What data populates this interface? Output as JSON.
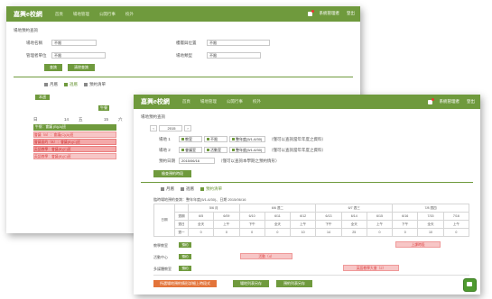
{
  "back_window": {
    "logo": "嘉興e校網",
    "nav": [
      "首頁",
      "場地管理",
      "公開行事",
      "校外"
    ],
    "topright": [
      "系統管理者",
      "登出"
    ],
    "section": "場地預約查詢",
    "fields": {
      "site": "場地名稱",
      "site_val": "不限",
      "bldg": "樓層與位置",
      "bldg_val": "不限",
      "manager": "管理者單位",
      "manager_val": "不限",
      "kind": "場地類型",
      "kind_val": "不限"
    },
    "buttons": {
      "query": "查詢",
      "reset": "清除查詢"
    },
    "tabs": [
      "月曆",
      "週曆",
      "預約清單"
    ],
    "week_btn": "本週",
    "col_labels": [
      "日",
      "14",
      "五",
      "15",
      "六"
    ],
    "green_tag": "午餐",
    "events": [
      "午餐：會議 (B)(A)班",
      "會議（B）：會議(C)(A)班",
      "會議區的（B）：會議(B)(C)班",
      "英語教學：會議(B)(C)班",
      "英語教學：會議(B)(C)班"
    ]
  },
  "front_window": {
    "logo": "嘉興e校網",
    "nav": [
      "首頁",
      "場地管理",
      "公開行事",
      "校外"
    ],
    "topright": [
      "系統管理者",
      "登出"
    ],
    "section": "場地預約查詢",
    "year": "2015",
    "rows": [
      {
        "label": "場地 1",
        "opts": [
          "教室",
          "不限",
          "整年度(5/1-6/30)"
        ],
        "note": "（僅可以查詢當年年度之資料）"
      },
      {
        "label": "場地 2",
        "opts": [
          "會議室",
          "活動室",
          "整年度(5/1-6/30)"
        ],
        "note": "（僅可以查詢當年年度之資料）"
      },
      {
        "label": "預約日期",
        "opts": [
          "2015/06/16"
        ],
        "note": "（僅可以查詢本學期之預約情形）"
      }
    ],
    "query_btn": "檢查預約時段",
    "tabs": [
      "月曆",
      "週曆",
      "預約清單"
    ],
    "sched_title": "臨時場地預約查詢：整年年度(5/1-6/30)、日期 2015/06/16",
    "headers": [
      "日期",
      "5/6 月",
      "6/6 週二",
      "6/7 週三",
      "7/8 週四"
    ],
    "subheaders": [
      "週期",
      "週日",
      "週一",
      "週二",
      "週三",
      "週四",
      "週五",
      "週六",
      "週日",
      "週一",
      "週二"
    ],
    "daterow": [
      "6/5",
      "6/09",
      "6/10",
      "6/11",
      "6/12",
      "6/13",
      "6/14",
      "6/15",
      "6/16",
      "7/15",
      "7/16"
    ],
    "kindrow": [
      "全天",
      "上午",
      "下午",
      "全天",
      "上午",
      "下午",
      "全天",
      "上午",
      "下午",
      "全天",
      "上午"
    ],
    "countrow": [
      "0",
      "0",
      "0",
      "0",
      "10",
      "14",
      "25",
      "0",
      "0",
      "10",
      "0"
    ],
    "places": [
      {
        "name": "教學教室",
        "btn": "預約"
      },
      {
        "name": "活動中心",
        "btn": "預約"
      },
      {
        "name": "多媒體教室",
        "btn": "預約"
      }
    ],
    "reservations": [
      "上課時段",
      "活動（4）",
      "英語教學大會（2）"
    ],
    "bottom_buttons": [
      "所選場地預約情形詳細上時段式",
      "場地列表另存",
      "預約列表另存"
    ],
    "colors": {
      "accent": "#6f9a3d",
      "danger": "#e3743a",
      "reserve": "#f7c6c6"
    }
  }
}
